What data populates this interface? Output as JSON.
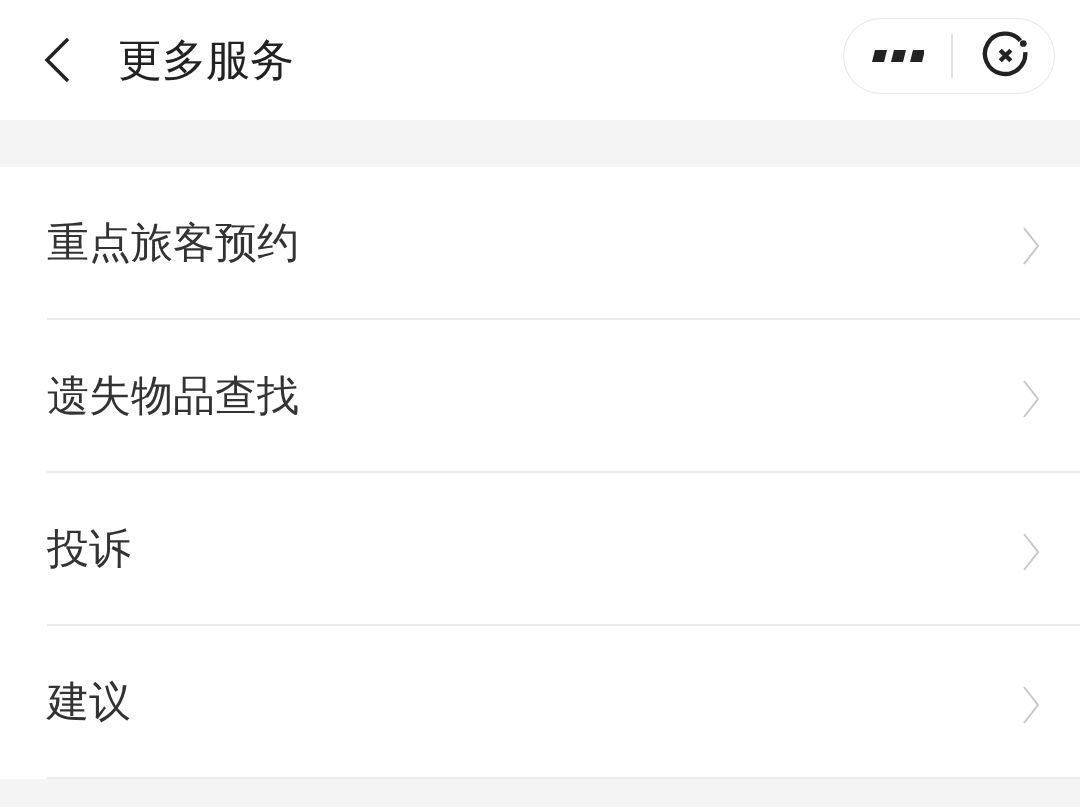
{
  "header": {
    "title": "更多服务"
  },
  "items": [
    {
      "label": "重点旅客预约"
    },
    {
      "label": "遗失物品查找"
    },
    {
      "label": "投诉"
    },
    {
      "label": "建议"
    }
  ]
}
